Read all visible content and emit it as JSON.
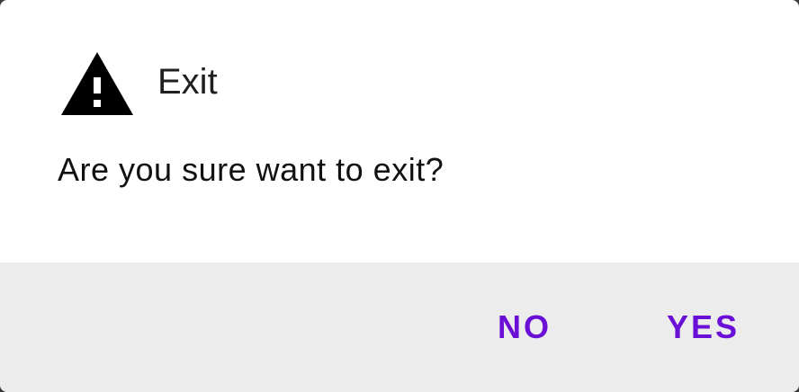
{
  "dialog": {
    "icon": "warning-icon",
    "title": "Exit",
    "message": "Are you sure want to exit?",
    "accent_color": "#6a0fd6",
    "actions": {
      "no_label": "NO",
      "yes_label": "YES"
    }
  }
}
